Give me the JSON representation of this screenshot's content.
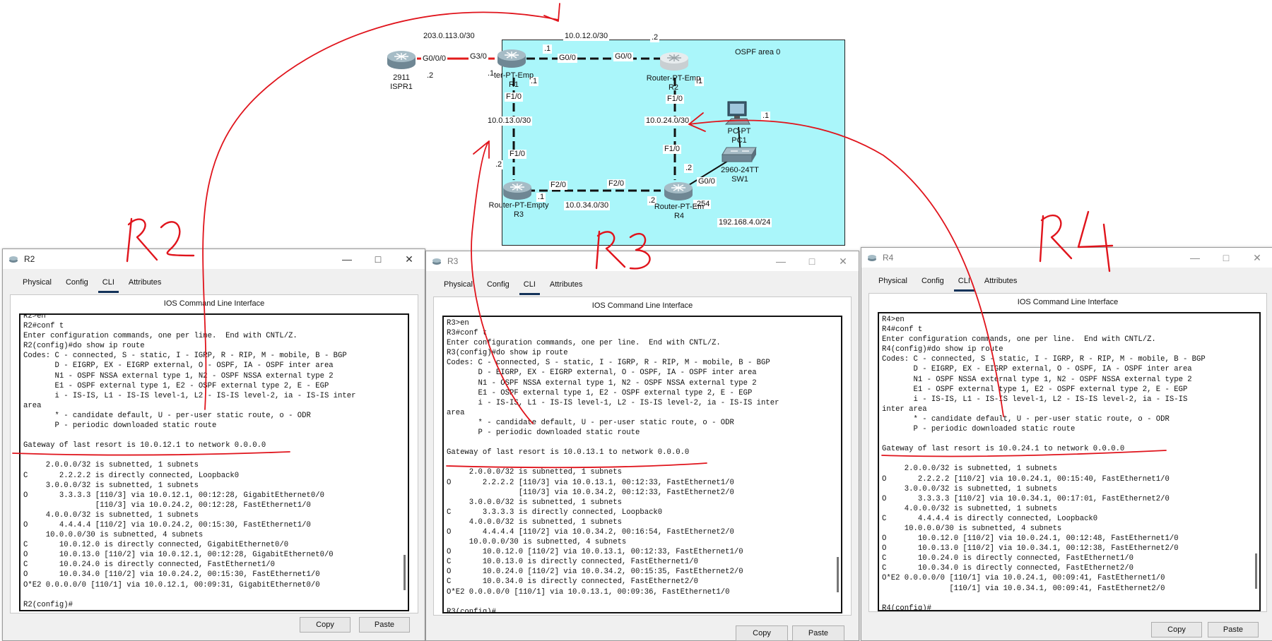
{
  "topology": {
    "area_label": "OSPF area 0",
    "link_labels": {
      "isp_net": "203.0.113.0/30",
      "r1_r2_net": "10.0.12.0/30",
      "r1_r3_net": "10.0.13.0/30",
      "r2_r4_net": "10.0.24.0/30",
      "r3_r4_net": "10.0.34.0/30",
      "lan_net": "192.168.4.0/24"
    },
    "interface_labels": {
      "isp_g000": "G0/0/0",
      "isp_host": ".2",
      "r1_g30": "G3/0",
      "r1_g00": "G0/0",
      "r1_dot1_a": ".1",
      "r1_dot1_b": ".1",
      "r1_dot1_c": ".1",
      "r1_f10": "F1/0",
      "r2_g00": "G0/0",
      "r2_dot2": ".2",
      "r2_dot1": ".1",
      "r2_f10": "F1/0",
      "r3_f10": "F1/0",
      "r3_dot2": ".2",
      "r3_f20": "F2/0",
      "r3_dot1": ".1",
      "r4_f20": "F2/0",
      "r4_dot2_a": ".2",
      "r4_f10": "F1/0",
      "r4_dot2_b": ".2",
      "r4_g00": "G0/0",
      "r4_254": ".254",
      "pc_dot1": ".1"
    },
    "devices": {
      "isp": {
        "model": "2911",
        "name": "ISPR1"
      },
      "r1": {
        "model": "ter-PT-Emp",
        "name": "R1"
      },
      "r2": {
        "model": "Router-PT-Emp",
        "name": "R2"
      },
      "r3": {
        "model": "Router-PT-Empty",
        "name": "R3"
      },
      "r4": {
        "model": "Router-PT-Em",
        "name": "R4"
      },
      "pc": {
        "model": "PC-PT",
        "name": "PC1"
      },
      "sw": {
        "model": "2960-24TT",
        "name": "SW1"
      }
    }
  },
  "annotations": {
    "r2": "R2",
    "r3": "R3",
    "r4": "R4"
  },
  "tabs": [
    "Physical",
    "Config",
    "CLI",
    "Attributes"
  ],
  "cli_header": "IOS Command Line Interface",
  "buttons": {
    "copy": "Copy",
    "paste": "Paste"
  },
  "windows": {
    "r2": {
      "title": "R2",
      "console": "R2>en\nR2#conf t\nEnter configuration commands, one per line.  End with CNTL/Z.\nR2(config)#do show ip route\nCodes: C - connected, S - static, I - IGRP, R - RIP, M - mobile, B - BGP\n       D - EIGRP, EX - EIGRP external, O - OSPF, IA - OSPF inter area\n       N1 - OSPF NSSA external type 1, N2 - OSPF NSSA external type 2\n       E1 - OSPF external type 1, E2 - OSPF external type 2, E - EGP\n       i - IS-IS, L1 - IS-IS level-1, L2 - IS-IS level-2, ia - IS-IS inter\narea\n       * - candidate default, U - per-user static route, o - ODR\n       P - periodic downloaded static route\n\nGateway of last resort is 10.0.12.1 to network 0.0.0.0\n\n     2.0.0.0/32 is subnetted, 1 subnets\nC       2.2.2.2 is directly connected, Loopback0\n     3.0.0.0/32 is subnetted, 1 subnets\nO       3.3.3.3 [110/3] via 10.0.12.1, 00:12:28, GigabitEthernet0/0\n                [110/3] via 10.0.24.2, 00:12:28, FastEthernet1/0\n     4.0.0.0/32 is subnetted, 1 subnets\nO       4.4.4.4 [110/2] via 10.0.24.2, 00:15:30, FastEthernet1/0\n     10.0.0.0/30 is subnetted, 4 subnets\nC       10.0.12.0 is directly connected, GigabitEthernet0/0\nO       10.0.13.0 [110/2] via 10.0.12.1, 00:12:28, GigabitEthernet0/0\nC       10.0.24.0 is directly connected, FastEthernet1/0\nO       10.0.34.0 [110/2] via 10.0.24.2, 00:15:30, FastEthernet1/0\nO*E2 0.0.0.0/0 [110/1] via 10.0.12.1, 00:09:31, GigabitEthernet0/0\n\nR2(config)#"
    },
    "r3": {
      "title": "R3",
      "console": "R3>en\nR3#conf t\nEnter configuration commands, one per line.  End with CNTL/Z.\nR3(config)#do show ip route\nCodes: C - connected, S - static, I - IGRP, R - RIP, M - mobile, B - BGP\n       D - EIGRP, EX - EIGRP external, O - OSPF, IA - OSPF inter area\n       N1 - OSPF NSSA external type 1, N2 - OSPF NSSA external type 2\n       E1 - OSPF external type 1, E2 - OSPF external type 2, E - EGP\n       i - IS-IS, L1 - IS-IS level-1, L2 - IS-IS level-2, ia - IS-IS inter\narea\n       * - candidate default, U - per-user static route, o - ODR\n       P - periodic downloaded static route\n\nGateway of last resort is 10.0.13.1 to network 0.0.0.0\n\n     2.0.0.0/32 is subnetted, 1 subnets\nO       2.2.2.2 [110/3] via 10.0.13.1, 00:12:33, FastEthernet1/0\n                [110/3] via 10.0.34.2, 00:12:33, FastEthernet2/0\n     3.0.0.0/32 is subnetted, 1 subnets\nC       3.3.3.3 is directly connected, Loopback0\n     4.0.0.0/32 is subnetted, 1 subnets\nO       4.4.4.4 [110/2] via 10.0.34.2, 00:16:54, FastEthernet2/0\n     10.0.0.0/30 is subnetted, 4 subnets\nO       10.0.12.0 [110/2] via 10.0.13.1, 00:12:33, FastEthernet1/0\nC       10.0.13.0 is directly connected, FastEthernet1/0\nO       10.0.24.0 [110/2] via 10.0.34.2, 00:15:35, FastEthernet2/0\nC       10.0.34.0 is directly connected, FastEthernet2/0\nO*E2 0.0.0.0/0 [110/1] via 10.0.13.1, 00:09:36, FastEthernet1/0\n\nR3(config)#"
    },
    "r4": {
      "title": "R4",
      "console": "R4>en\nR4#conf t\nEnter configuration commands, one per line.  End with CNTL/Z.\nR4(config)#do show ip route\nCodes: C - connected, S - static, I - IGRP, R - RIP, M - mobile, B - BGP\n       D - EIGRP, EX - EIGRP external, O - OSPF, IA - OSPF inter area\n       N1 - OSPF NSSA external type 1, N2 - OSPF NSSA external type 2\n       E1 - OSPF external type 1, E2 - OSPF external type 2, E - EGP\n       i - IS-IS, L1 - IS-IS level-1, L2 - IS-IS level-2, ia - IS-IS\ninter area\n       * - candidate default, U - per-user static route, o - ODR\n       P - periodic downloaded static route\n\nGateway of last resort is 10.0.24.1 to network 0.0.0.0\n\n     2.0.0.0/32 is subnetted, 1 subnets\nO       2.2.2.2 [110/2] via 10.0.24.1, 00:15:40, FastEthernet1/0\n     3.0.0.0/32 is subnetted, 1 subnets\nO       3.3.3.3 [110/2] via 10.0.34.1, 00:17:01, FastEthernet2/0\n     4.0.0.0/32 is subnetted, 1 subnets\nC       4.4.4.4 is directly connected, Loopback0\n     10.0.0.0/30 is subnetted, 4 subnets\nO       10.0.12.0 [110/2] via 10.0.24.1, 00:12:48, FastEthernet1/0\nO       10.0.13.0 [110/2] via 10.0.34.1, 00:12:38, FastEthernet2/0\nC       10.0.24.0 is directly connected, FastEthernet1/0\nC       10.0.34.0 is directly connected, FastEthernet2/0\nO*E2 0.0.0.0/0 [110/1] via 10.0.24.1, 00:09:41, FastEthernet1/0\n               [110/1] via 10.0.34.1, 00:09:41, FastEthernet2/0\n\nR4(config)#"
    }
  }
}
